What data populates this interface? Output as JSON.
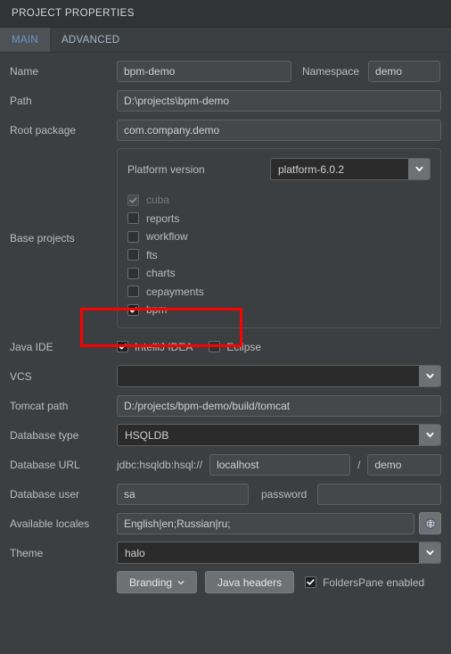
{
  "window": {
    "title": "PROJECT PROPERTIES"
  },
  "tabs": [
    {
      "label": "MAIN",
      "active": true
    },
    {
      "label": "ADVANCED",
      "active": false
    }
  ],
  "fields": {
    "name": {
      "label": "Name",
      "value": "bpm-demo"
    },
    "namespace": {
      "label": "Namespace",
      "value": "demo"
    },
    "path": {
      "label": "Path",
      "value": "D:\\projects\\bpm-demo"
    },
    "root_package": {
      "label": "Root package",
      "value": "com.company.demo"
    },
    "base_projects": {
      "label": "Base projects"
    },
    "platform_version": {
      "label": "Platform version",
      "value": "platform-6.0.2"
    },
    "java_ide": {
      "label": "Java IDE"
    },
    "vcs": {
      "label": "VCS",
      "value": ""
    },
    "tomcat_path": {
      "label": "Tomcat path",
      "value": "D:/projects/bpm-demo/build/tomcat"
    },
    "database_type": {
      "label": "Database type",
      "value": "HSQLDB"
    },
    "database_url": {
      "label": "Database URL",
      "prefix": "jdbc:hsqldb:hsql://",
      "host": "localhost",
      "separator": "/",
      "db": "demo"
    },
    "database_user": {
      "label": "Database user",
      "value": "sa",
      "password_label": "password",
      "password_value": ""
    },
    "available_locales": {
      "label": "Available locales",
      "value": "English|en;Russian|ru;"
    },
    "theme": {
      "label": "Theme",
      "value": "halo"
    }
  },
  "base_projects_list": [
    {
      "label": "cuba",
      "checked": true,
      "disabled": true
    },
    {
      "label": "reports",
      "checked": false,
      "disabled": false
    },
    {
      "label": "workflow",
      "checked": false,
      "disabled": false
    },
    {
      "label": "fts",
      "checked": false,
      "disabled": false
    },
    {
      "label": "charts",
      "checked": false,
      "disabled": false
    },
    {
      "label": "cepayments",
      "checked": false,
      "disabled": false
    },
    {
      "label": "bpm",
      "checked": true,
      "disabled": false
    }
  ],
  "java_ide_options": [
    {
      "label": "IntelliJ IDEA",
      "checked": true
    },
    {
      "label": "Eclipse",
      "checked": false
    }
  ],
  "buttons": {
    "branding": "Branding",
    "java_headers": "Java headers"
  },
  "folders_pane": {
    "label": "FoldersPane enabled",
    "checked": true
  },
  "icons": {
    "chevron_down": "chevron-down-icon",
    "globe": "globe-icon",
    "check": "check-icon"
  },
  "colors": {
    "background": "#3c3f41",
    "titlebar": "#313335",
    "accent_tab": "#6897d4",
    "annotation": "#ff0000",
    "field_dark": "#2b2b2b",
    "button": "#6e7174"
  },
  "annotation": {
    "name": "red-highlight-rectangle",
    "target": "bpm"
  }
}
